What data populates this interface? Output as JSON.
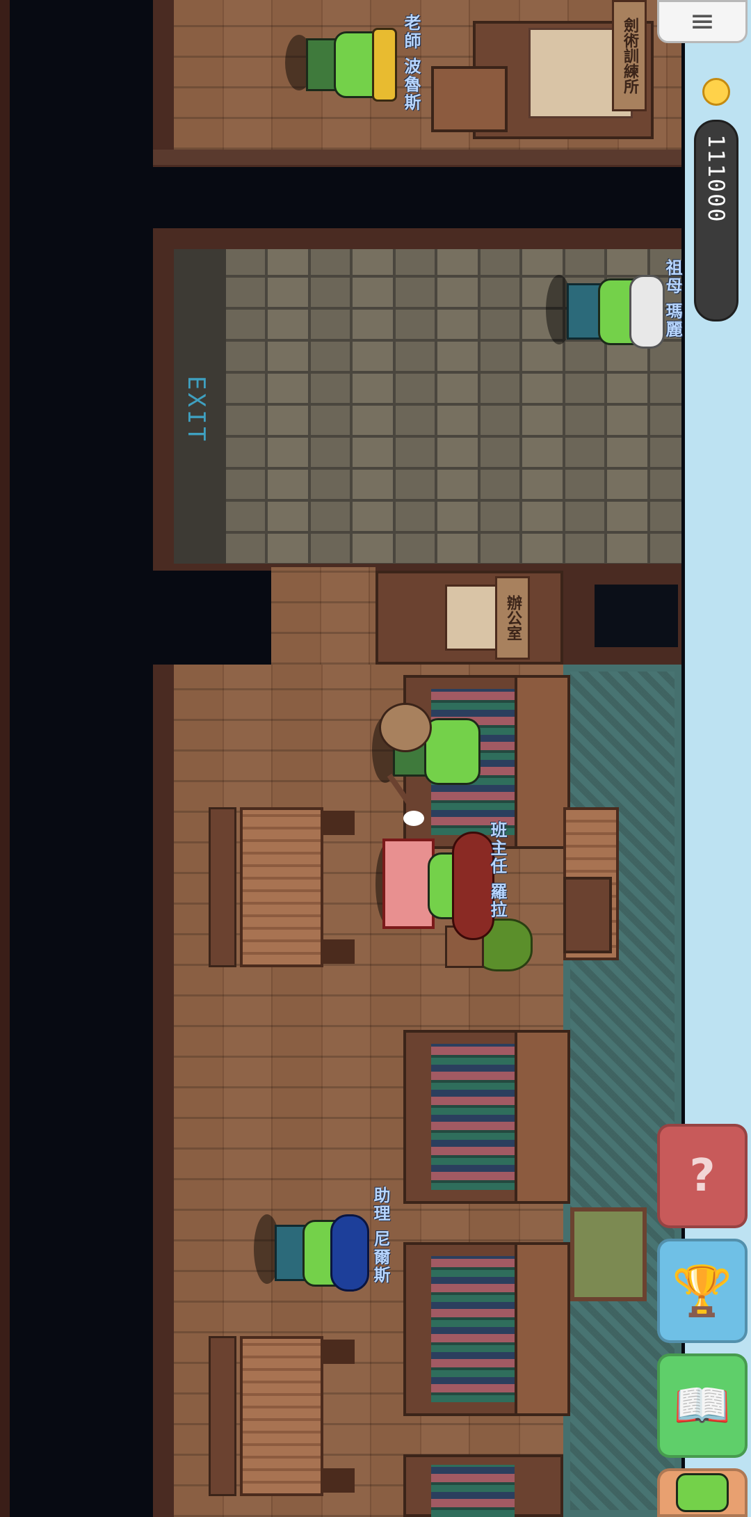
{
  "hud": {
    "coins": "111000",
    "menu_icon": "hamburger-menu-icon",
    "coin_icon": "gold-coin-icon"
  },
  "map": {
    "exit_label": "EXIT",
    "office_sign": "辦公室",
    "training_sign": "劍術訓練所"
  },
  "characters": {
    "teacher": "老師 波魯斯",
    "guide": "祖母 瑪麗",
    "homeroom": "班主任 羅拉",
    "assistant": "助理 尼爾斯"
  },
  "side_buttons": [
    {
      "label": "unknown-card-button",
      "icon": "question-card-icon",
      "color": "#c85a5a"
    },
    {
      "label": "trophy-button",
      "icon": "trophy-icon",
      "color": "#6fc0e6"
    },
    {
      "label": "book-button",
      "icon": "book-icon",
      "color": "#5fcf6a"
    },
    {
      "label": "character-button",
      "icon": "goblin-face-icon",
      "color": "#e8a070"
    }
  ]
}
